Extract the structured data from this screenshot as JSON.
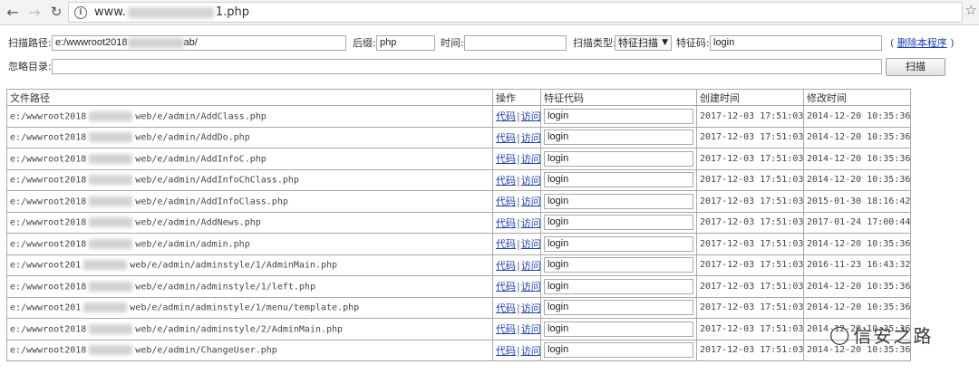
{
  "browser": {
    "url_prefix": "www.",
    "url_suffix": "1.php"
  },
  "form": {
    "scan_path_label": "扫描路径:",
    "scan_path_prefix": "e:/wwwroot2018",
    "scan_path_suffix": "ab/",
    "suffix_label": "后缀:",
    "suffix_value": "php",
    "time_label": "时间:",
    "time_value": "",
    "scan_type_label": "扫描类型:",
    "scan_type_value": "特征扫描",
    "signature_label": "特征码:",
    "signature_value": "login",
    "delete_link": "删除本程序",
    "ignore_label": "忽略目录:",
    "ignore_value": "",
    "scan_button": "扫描"
  },
  "table": {
    "headers": [
      "文件路径",
      "操作",
      "特征代码",
      "创建时间",
      "修改时间"
    ],
    "action_code": "代码",
    "action_visit": "访问",
    "rows": [
      {
        "prefix": "e:/wwwroot2018",
        "suffix": "web/e/admin/AddClass.php",
        "sig": "login",
        "created": "2017-12-03 17:51:03",
        "modified": "2014-12-20 10:35:36"
      },
      {
        "prefix": "e:/wwwroot2018",
        "suffix": "web/e/admin/AddDo.php",
        "sig": "login",
        "created": "2017-12-03 17:51:03",
        "modified": "2014-12-20 10:35:36"
      },
      {
        "prefix": "e:/wwwroot2018",
        "suffix": "web/e/admin/AddInfoC.php",
        "sig": "login",
        "created": "2017-12-03 17:51:03",
        "modified": "2014-12-20 10:35:36"
      },
      {
        "prefix": "e:/wwwroot2018",
        "suffix": "web/e/admin/AddInfoChClass.php",
        "sig": "login",
        "created": "2017-12-03 17:51:03",
        "modified": "2014-12-20 10:35:36"
      },
      {
        "prefix": "e:/wwwroot2018",
        "suffix": "web/e/admin/AddInfoClass.php",
        "sig": "login",
        "created": "2017-12-03 17:51:03",
        "modified": "2015-01-30 18:16:42"
      },
      {
        "prefix": "e:/wwwroot2018",
        "suffix": "web/e/admin/AddNews.php",
        "sig": "login",
        "created": "2017-12-03 17:51:03",
        "modified": "2017-01-24 17:00:44"
      },
      {
        "prefix": "e:/wwwroot2018",
        "suffix": "web/e/admin/admin.php",
        "sig": "login",
        "created": "2017-12-03 17:51:03",
        "modified": "2014-12-20 10:35:36"
      },
      {
        "prefix": "e:/wwwroot201",
        "suffix": "web/e/admin/adminstyle/1/AdminMain.php",
        "sig": "login",
        "created": "2017-12-03 17:51:03",
        "modified": "2016-11-23 16:43:32"
      },
      {
        "prefix": "e:/wwwroot2018",
        "suffix": "web/e/admin/adminstyle/1/left.php",
        "sig": "login",
        "created": "2017-12-03 17:51:03",
        "modified": "2014-12-20 10:35:36"
      },
      {
        "prefix": "e:/wwwroot201",
        "suffix": "web/e/admin/adminstyle/1/menu/template.php",
        "sig": "login",
        "created": "2017-12-03 17:51:03",
        "modified": "2014-12-20 10:35:36"
      },
      {
        "prefix": "e:/wwwroot2018",
        "suffix": "web/e/admin/adminstyle/2/AdminMain.php",
        "sig": "login",
        "created": "2017-12-03 17:51:03",
        "modified": "2014-12-20 10:35:36"
      },
      {
        "prefix": "e:/wwwroot2018",
        "suffix": "web/e/admin/ChangeUser.php",
        "sig": "login",
        "created": "2017-12-03 17:51:03",
        "modified": "2014-12-20 10:35:36"
      }
    ]
  },
  "watermark": {
    "text": "信安之路"
  }
}
